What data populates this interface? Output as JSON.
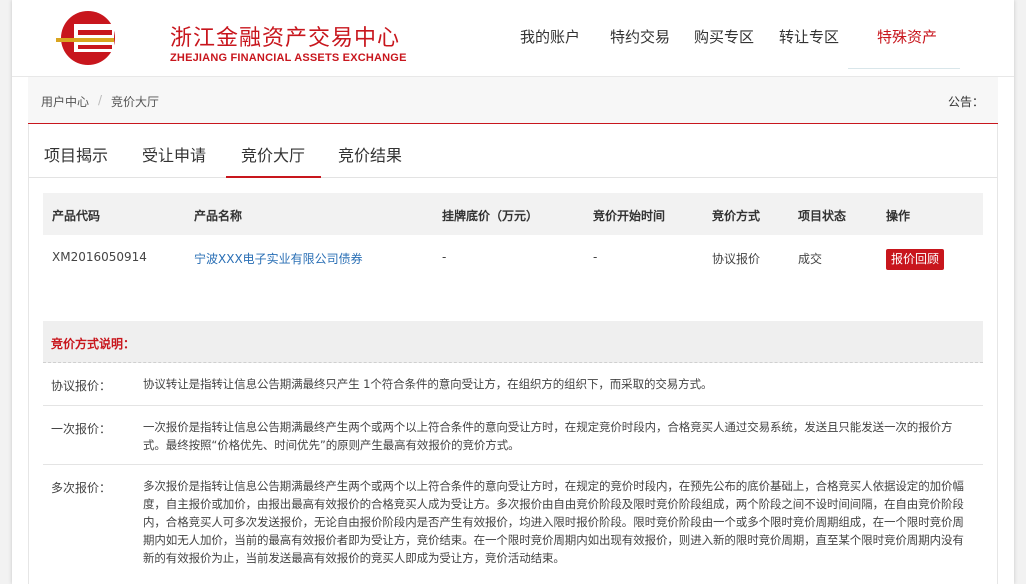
{
  "colors": {
    "brand_red": "#c8161d",
    "link_blue": "#2a6fb5"
  },
  "header": {
    "logo_icon": "zjfae-logo-icon",
    "logo_cn": "浙江金融资产交易中心",
    "logo_en": "ZHEJIANG FINANCIAL ASSETS EXCHANGE",
    "nav": [
      "我的账户",
      "特约交易",
      "购买专区",
      "转让专区",
      "特殊资产"
    ]
  },
  "breadcrumb": {
    "home": "用户中心",
    "sep": "/",
    "current": "竞价大厅"
  },
  "notice_label": "公告：",
  "tabs": [
    "项目揭示",
    "受让申请",
    "竞价大厅",
    "竞价结果"
  ],
  "table": {
    "headers": [
      "产品代码",
      "产品名称",
      "挂牌底价（万元）",
      "竞价开始时间",
      "竞价方式",
      "项目状态",
      "操作"
    ],
    "row": {
      "code": "XM2016050914",
      "name": "宁波XXX电子实业有限公司债券",
      "base_price": "-",
      "start_time": "-",
      "method": "协议报价",
      "status": "成交",
      "action": "报价回顾"
    }
  },
  "explanation": {
    "title": "竞价方式说明：",
    "items": [
      {
        "label": "协议报价：",
        "text": "协议转让是指转让信息公告期满最终只产生 1个符合条件的意向受让方，在组织方的组织下，而采取的交易方式。"
      },
      {
        "label": "一次报价：",
        "text": "一次报价是指转让信息公告期满最终产生两个或两个以上符合条件的意向受让方时，在规定竞价时段内，合格竞买人通过交易系统，发送且只能发送一次的报价方式。最终按照“价格优先、时间优先”的原则产生最高有效报价的竞价方式。"
      },
      {
        "label": "多次报价：",
        "text": "多次报价是指转让信息公告期满最终产生两个或两个以上符合条件的意向受让方时，在规定的竞价时段内，在预先公布的底价基础上，合格竞买人依据设定的加价幅度，自主报价或加价，由报出最高有效报价的合格竞买人成为受让方。多次报价由自由竞价阶段及限时竞价阶段组成，两个阶段之间不设时间间隔，在自由竞价阶段内，合格竞买人可多次发送报价，无论自由报价阶段内是否产生有效报价，均进入限时报价阶段。限时竞价阶段由一个或多个限时竞价周期组成，在一个限时竞价周期内如无人加价，当前的最高有效报价者即为受让方，竞价结束。在一个限时竞价周期内如出现有效报价，则进入新的限时竞价周期，直至某个限时竞价周期内没有新的有效报价为止，当前发送最高有效报价的竞买人即成为受让方，竞价活动结束。"
      }
    ]
  }
}
